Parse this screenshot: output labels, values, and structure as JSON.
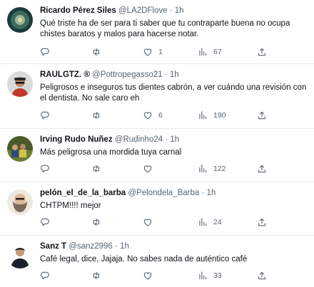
{
  "tweets": [
    {
      "name": "Ricardo Pérez Siles",
      "handle": "@LA2DFlove",
      "dot": "·",
      "time": "1h",
      "text": "Qué triste ha de ser para ti saber que tu contraparte buena no ocupa chistes baratos y malos para hacerse notar.",
      "replies": "",
      "retweets": "",
      "likes": "1",
      "views": "67"
    },
    {
      "name": "RAULGTZ. ®",
      "handle": "@Pottropegasso21",
      "dot": "·",
      "time": "1h",
      "text": "Peligrosos e inseguros tus dientes cabrón, a ver cuándo una revisión con el dentista. No sale caro eh",
      "replies": "",
      "retweets": "",
      "likes": "6",
      "views": "190"
    },
    {
      "name": "Irving Rudo Nuñez",
      "handle": "@Rudinho24",
      "dot": "·",
      "time": "1h",
      "text": "Más peligrosa una mordida tuya carnal",
      "replies": "",
      "retweets": "",
      "likes": "",
      "views": "122"
    },
    {
      "name": "pelón_el_de_la_barba",
      "handle": "@Pelondela_Barba",
      "dot": "·",
      "time": "1h",
      "text": "CHTPM!!!! mejor",
      "replies": "",
      "retweets": "",
      "likes": "",
      "views": "24"
    },
    {
      "name": "Sanz T",
      "handle": "@sanz2996",
      "dot": "·",
      "time": "1h",
      "text": "Café legal, dice, Jajaja. No sabes nada de auténtico café",
      "replies": "",
      "retweets": "",
      "likes": "",
      "views": "33"
    }
  ],
  "icons": {
    "reply": "reply-icon",
    "retweet": "retweet-icon",
    "like": "heart-icon",
    "views": "views-chart-icon",
    "share": "share-icon"
  },
  "colors": {
    "name": "#0f1419",
    "secondary": "#536471",
    "divider": "#e6ecf0"
  }
}
